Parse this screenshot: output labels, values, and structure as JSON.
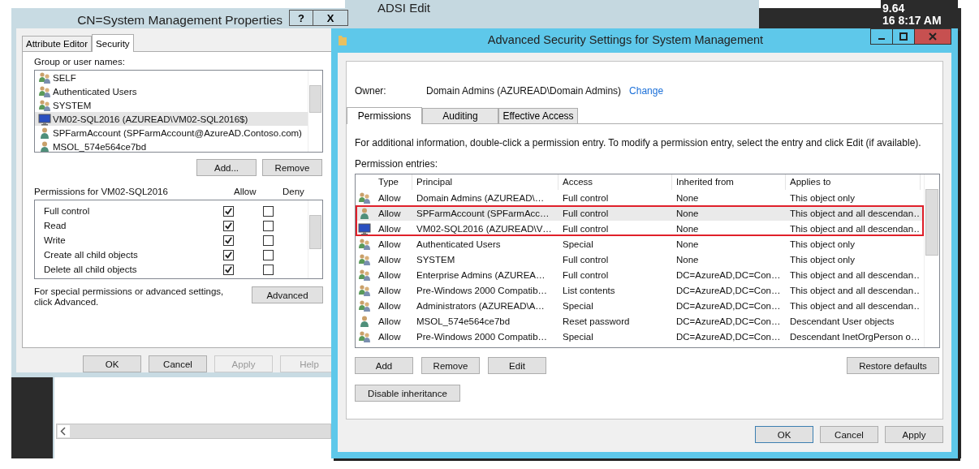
{
  "background_window": {
    "title": "ADSI Edit"
  },
  "tray": {
    "texts": [
      "9.64",
      "16 8:17 AM"
    ]
  },
  "properties_dialog": {
    "title": "CN=System Management Properties",
    "help_button": "?",
    "close_button": "X",
    "tabs": [
      {
        "label": "Attribute Editor",
        "selected": false
      },
      {
        "label": "Security",
        "selected": true
      }
    ],
    "group_label": "Group or user names:",
    "principals": [
      {
        "kind": "group",
        "name": "SELF",
        "selected": false
      },
      {
        "kind": "group",
        "name": "Authenticated Users",
        "selected": false
      },
      {
        "kind": "group",
        "name": "SYSTEM",
        "selected": false
      },
      {
        "kind": "computer",
        "name": "VM02-SQL2016 (AZUREAD\\VM02-SQL2016$)",
        "selected": true
      },
      {
        "kind": "user",
        "name": "SPFarmAccount (SPFarmAccount@AzureAD.Contoso.com)",
        "selected": false
      },
      {
        "kind": "user",
        "name": "MSOL_574e564ce7bd",
        "selected": false
      }
    ],
    "list_buttons": [
      "Add...",
      "Remove"
    ],
    "permissions_label": "Permissions for VM02-SQL2016",
    "allow_header": "Allow",
    "deny_header": "Deny",
    "permissions": [
      {
        "name": "Full control",
        "allow": true,
        "deny": false
      },
      {
        "name": "Read",
        "allow": true,
        "deny": false
      },
      {
        "name": "Write",
        "allow": true,
        "deny": false
      },
      {
        "name": "Create all child objects",
        "allow": true,
        "deny": false
      },
      {
        "name": "Delete all child objects",
        "allow": true,
        "deny": false
      }
    ],
    "note": "For special permissions or advanced settings, click Advanced.",
    "advanced_button": "Advanced",
    "footer_buttons": [
      {
        "label": "OK",
        "disabled": false
      },
      {
        "label": "Cancel",
        "disabled": false
      },
      {
        "label": "Apply",
        "disabled": true
      },
      {
        "label": "Help",
        "disabled": true
      }
    ]
  },
  "advanced_dialog": {
    "title": "Advanced Security Settings for System Management",
    "owner_label": "Owner:",
    "owner_value": "Domain Admins (AZUREAD\\Domain Admins)",
    "change_link": "Change",
    "tabs": [
      {
        "label": "Permissions",
        "selected": true
      },
      {
        "label": "Auditing",
        "selected": false
      },
      {
        "label": "Effective Access",
        "selected": false
      }
    ],
    "info": "For additional information, double-click a permission entry. To modify a permission entry, select the entry and click Edit (if available).",
    "entries_label": "Permission entries:",
    "columns": [
      "Type",
      "Principal",
      "Access",
      "Inherited from",
      "Applies to"
    ],
    "entries": [
      {
        "kind": "group",
        "type": "Allow",
        "principal": "Domain Admins (AZUREAD\\…",
        "access": "Full control",
        "inherited_from": "None",
        "applies_to": "This object only",
        "selected": false,
        "highlighted": false
      },
      {
        "kind": "user",
        "type": "Allow",
        "principal": "SPFarmAccount (SPFarmAcc…",
        "access": "Full control",
        "inherited_from": "None",
        "applies_to": "This object and all descendan…",
        "selected": true,
        "highlighted": true
      },
      {
        "kind": "computer",
        "type": "Allow",
        "principal": "VM02-SQL2016 (AZUREAD\\V…",
        "access": "Full control",
        "inherited_from": "None",
        "applies_to": "This object and all descendan…",
        "selected": false,
        "highlighted": true
      },
      {
        "kind": "group",
        "type": "Allow",
        "principal": "Authenticated Users",
        "access": "Special",
        "inherited_from": "None",
        "applies_to": "This object only",
        "selected": false,
        "highlighted": false
      },
      {
        "kind": "group",
        "type": "Allow",
        "principal": "SYSTEM",
        "access": "Full control",
        "inherited_from": "None",
        "applies_to": "This object only",
        "selected": false,
        "highlighted": false
      },
      {
        "kind": "group",
        "type": "Allow",
        "principal": "Enterprise Admins (AZUREA…",
        "access": "Full control",
        "inherited_from": "DC=AzureAD,DC=Con…",
        "applies_to": "This object and all descendan…",
        "selected": false,
        "highlighted": false
      },
      {
        "kind": "group",
        "type": "Allow",
        "principal": "Pre-Windows 2000 Compatib…",
        "access": "List contents",
        "inherited_from": "DC=AzureAD,DC=Con…",
        "applies_to": "This object and all descendan…",
        "selected": false,
        "highlighted": false
      },
      {
        "kind": "group",
        "type": "Allow",
        "principal": "Administrators (AZUREAD\\A…",
        "access": "Special",
        "inherited_from": "DC=AzureAD,DC=Con…",
        "applies_to": "This object and all descendan…",
        "selected": false,
        "highlighted": false
      },
      {
        "kind": "user",
        "type": "Allow",
        "principal": "MSOL_574e564ce7bd",
        "access": "Reset password",
        "inherited_from": "DC=AzureAD,DC=Con…",
        "applies_to": "Descendant User objects",
        "selected": false,
        "highlighted": false
      },
      {
        "kind": "group",
        "type": "Allow",
        "principal": "Pre-Windows 2000 Compatib…",
        "access": "Special",
        "inherited_from": "DC=AzureAD,DC=Con…",
        "applies_to": "Descendant InetOrgPerson o…",
        "selected": false,
        "highlighted": false
      }
    ],
    "entry_buttons": [
      "Add",
      "Remove",
      "Edit"
    ],
    "restore_button": "Restore defaults",
    "inheritance_button": "Disable inheritance",
    "footer_buttons": [
      "OK",
      "Cancel",
      "Apply"
    ]
  }
}
